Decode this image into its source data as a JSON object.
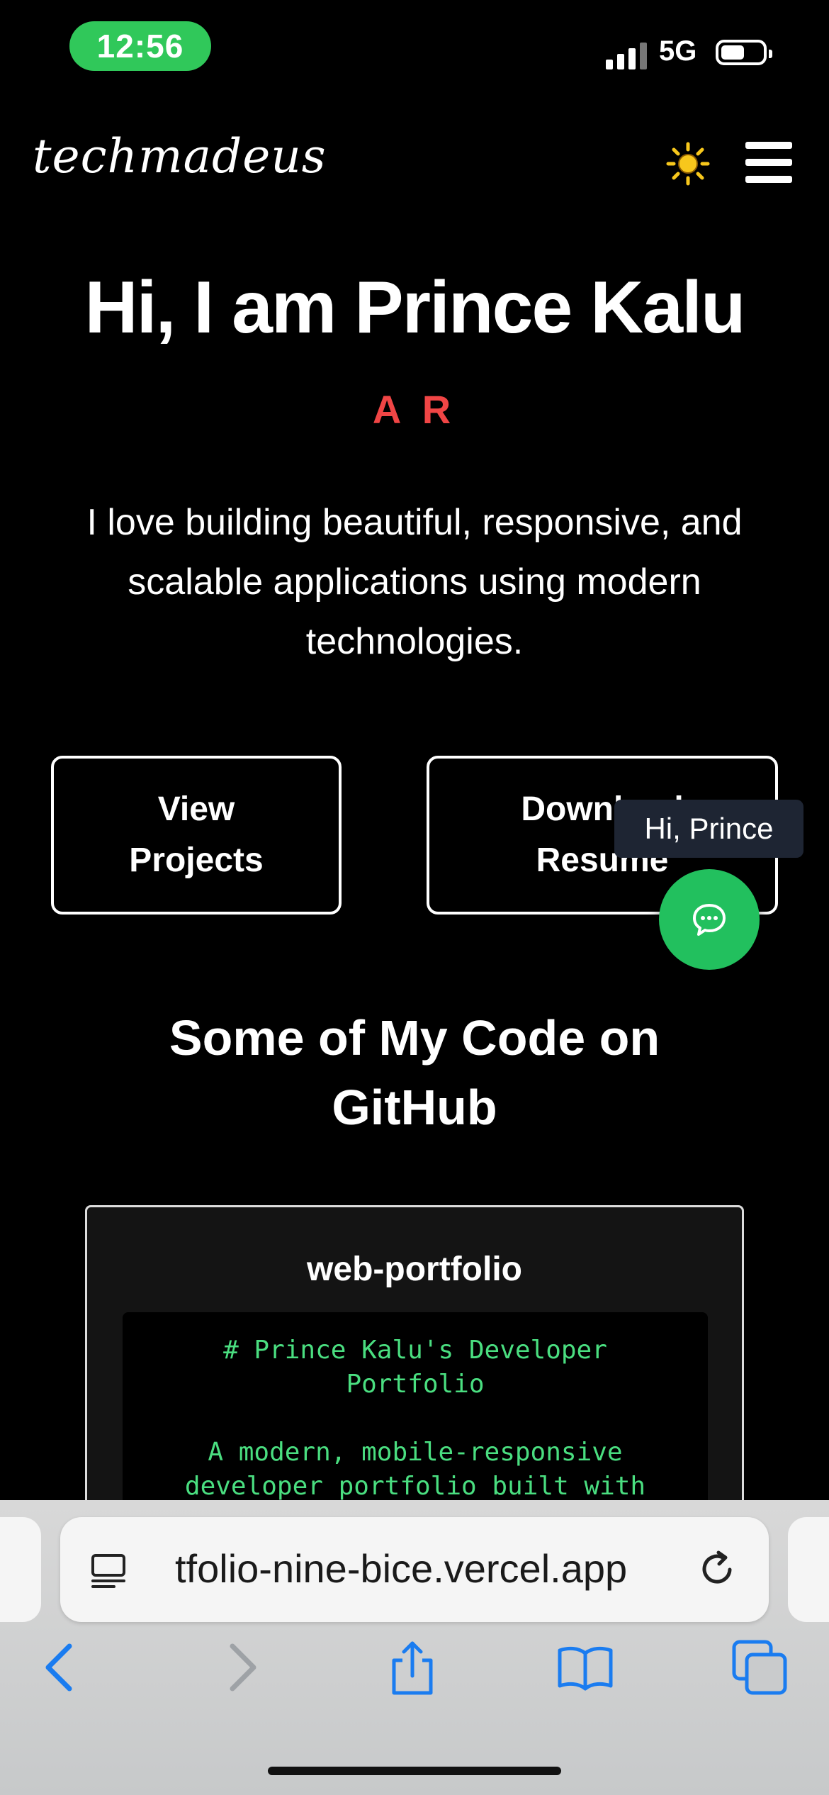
{
  "status_bar": {
    "time": "12:56",
    "network": "5G"
  },
  "header": {
    "logo": "techmadeus",
    "theme_icon": "sun-icon",
    "menu_icon": "hamburger-icon"
  },
  "hero": {
    "title": "Hi, I am Prince Kalu",
    "role_text": "A R",
    "description": "I love building beautiful, responsive, and scalable applications using modern technologies."
  },
  "buttons": {
    "view_projects": "View Projects",
    "download_resume": "Download Resume"
  },
  "chat": {
    "tooltip": "Hi, Prince",
    "icon": "chat-bubble-icon"
  },
  "github_section": {
    "title": "Some of My Code on GitHub",
    "card": {
      "title": "web-portfolio",
      "code_lines": "# Prince Kalu's Developer\nPortfolio\n\nA modern, mobile-responsive\ndeveloper portfolio built with"
    }
  },
  "browser": {
    "url": "tfolio-nine-bice.vercel.app",
    "toolbar": [
      "back-icon",
      "forward-icon",
      "share-icon",
      "bookmarks-icon",
      "tabs-icon"
    ]
  },
  "colors": {
    "accent_red": "#f04545",
    "chat_green": "#22c05e",
    "code_green": "#4ade80",
    "time_pill": "#30c85a",
    "safari_blue": "#1a7cf0"
  }
}
